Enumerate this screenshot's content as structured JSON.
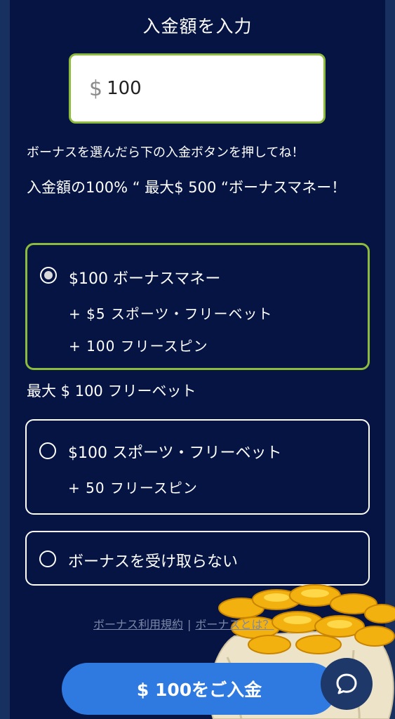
{
  "header": {
    "title": "入金額を入力"
  },
  "amount": {
    "currency": "$",
    "value": "100"
  },
  "hint": "ボーナスを選んだら下の入金ボタンを押してね！",
  "bonus_max_text": "入金額の100% “ 最大$ 500 “ボーナスマネー！",
  "options": [
    {
      "title": "$100 ボーナスマネー",
      "sub1": "+  $5  スポーツ・フリーベット",
      "sub2": "+  100  フリースピン",
      "selected": true
    },
    {
      "title": "$100 スポーツ・フリーベット",
      "sub1": "+  50  フリースピン",
      "selected": false
    },
    {
      "title": "ボーナスを受け取らない",
      "selected": false
    }
  ],
  "freebet_label": "最大 $ 100 フリーベット",
  "links": {
    "terms": "ボーナス利用規約",
    "separator": "|",
    "about": "ボーナスとは？"
  },
  "deposit_button": "$ 100をご入金",
  "colors": {
    "accent_green": "#8dbb3c",
    "button_blue": "#2f7ae0",
    "panel_bg": "#051442"
  },
  "icons": {
    "chat": "chat-bubble-icon",
    "illustration": "coin-bag-image"
  }
}
